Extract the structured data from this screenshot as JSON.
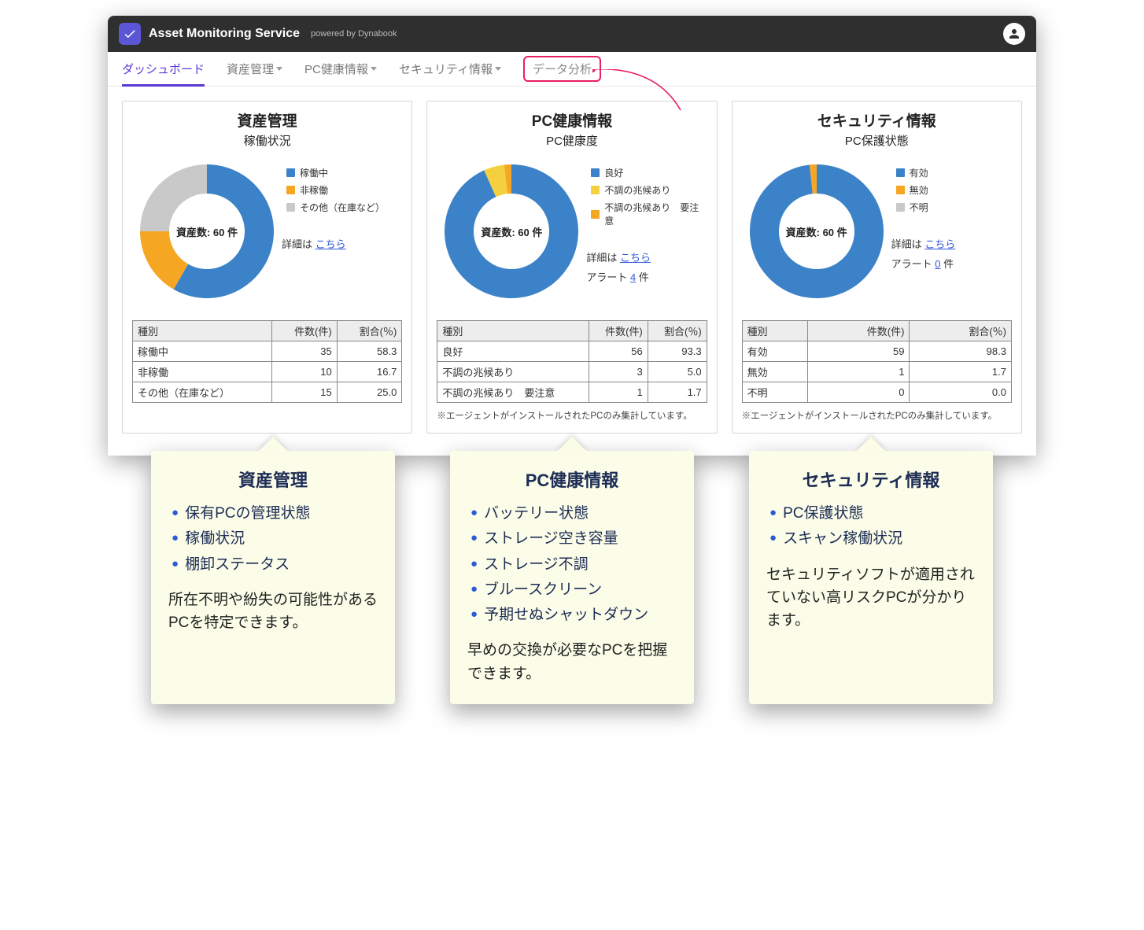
{
  "header": {
    "app_title": "Asset Monitoring Service",
    "app_subtitle": "powered by Dynabook"
  },
  "nav": {
    "items": [
      {
        "label": "ダッシュボード",
        "active": true,
        "dropdown": false
      },
      {
        "label": "資産管理",
        "active": false,
        "dropdown": true
      },
      {
        "label": "PC健康情報",
        "active": false,
        "dropdown": true
      },
      {
        "label": "セキュリティ情報",
        "active": false,
        "dropdown": true
      },
      {
        "label": "データ分析",
        "active": false,
        "dropdown": false,
        "highlight": true
      }
    ]
  },
  "colors": {
    "blue": "#3b82c8",
    "orange": "#f5a623",
    "gray": "#c9c9c9",
    "yellow": "#f4d03f"
  },
  "cards": [
    {
      "title": "資産管理",
      "subtitle": "稼働状況",
      "center_label": "資産数: 60 件",
      "legend": [
        {
          "label": "稼働中",
          "color": "#3b82c8"
        },
        {
          "label": "非稼働",
          "color": "#f5a623"
        },
        {
          "label": "その他（在庫など）",
          "color": "#c9c9c9"
        }
      ],
      "detail_prefix": "詳細は ",
      "detail_link": "こちら",
      "alert_prefix": null,
      "alert_count": null,
      "alert_suffix": null,
      "table": {
        "headers": [
          "種別",
          "件数(件)",
          "割合(％)"
        ],
        "rows": [
          [
            "稼働中",
            "35",
            "58.3"
          ],
          [
            "非稼働",
            "10",
            "16.7"
          ],
          [
            "その他（在庫など）",
            "15",
            "25.0"
          ]
        ]
      },
      "footnote": null
    },
    {
      "title": "PC健康情報",
      "subtitle": "PC健康度",
      "center_label": "資産数: 60 件",
      "legend": [
        {
          "label": "良好",
          "color": "#3b82c8"
        },
        {
          "label": "不調の兆候あり",
          "color": "#f4d03f"
        },
        {
          "label": "不調の兆候あり　要注意",
          "color": "#f5a623"
        }
      ],
      "detail_prefix": "詳細は ",
      "detail_link": "こちら",
      "alert_prefix": "アラート ",
      "alert_count": "4",
      "alert_suffix": " 件",
      "table": {
        "headers": [
          "種別",
          "件数(件)",
          "割合(％)"
        ],
        "rows": [
          [
            "良好",
            "56",
            "93.3"
          ],
          [
            "不調の兆候あり",
            "3",
            "5.0"
          ],
          [
            "不調の兆候あり　要注意",
            "1",
            "1.7"
          ]
        ]
      },
      "footnote": "※エージェントがインストールされたPCのみ集計しています。"
    },
    {
      "title": "セキュリティ情報",
      "subtitle": "PC保護状態",
      "center_label": "資産数: 60 件",
      "legend": [
        {
          "label": "有効",
          "color": "#3b82c8"
        },
        {
          "label": "無効",
          "color": "#f5a623"
        },
        {
          "label": "不明",
          "color": "#c9c9c9"
        }
      ],
      "detail_prefix": "詳細は ",
      "detail_link": "こちら",
      "alert_prefix": "アラート ",
      "alert_count": "0",
      "alert_suffix": " 件",
      "table": {
        "headers": [
          "種別",
          "件数(件)",
          "割合(％)"
        ],
        "rows": [
          [
            "有効",
            "59",
            "98.3"
          ],
          [
            "無効",
            "1",
            "1.7"
          ],
          [
            "不明",
            "0",
            "0.0"
          ]
        ]
      },
      "footnote": "※エージェントがインストールされたPCのみ集計しています。"
    }
  ],
  "chart_data": [
    {
      "type": "pie",
      "title": "資産管理 / 稼働状況",
      "total_label": "資産数: 60 件",
      "series": [
        {
          "name": "稼働中",
          "value": 35,
          "percent": 58.3,
          "color": "#3b82c8"
        },
        {
          "name": "非稼働",
          "value": 10,
          "percent": 16.7,
          "color": "#f5a623"
        },
        {
          "name": "その他（在庫など）",
          "value": 15,
          "percent": 25.0,
          "color": "#c9c9c9"
        }
      ]
    },
    {
      "type": "pie",
      "title": "PC健康情報 / PC健康度",
      "total_label": "資産数: 60 件",
      "series": [
        {
          "name": "良好",
          "value": 56,
          "percent": 93.3,
          "color": "#3b82c8"
        },
        {
          "name": "不調の兆候あり",
          "value": 3,
          "percent": 5.0,
          "color": "#f4d03f"
        },
        {
          "name": "不調の兆候あり　要注意",
          "value": 1,
          "percent": 1.7,
          "color": "#f5a623"
        }
      ]
    },
    {
      "type": "pie",
      "title": "セキュリティ情報 / PC保護状態",
      "total_label": "資産数: 60 件",
      "series": [
        {
          "name": "有効",
          "value": 59,
          "percent": 98.3,
          "color": "#3b82c8"
        },
        {
          "name": "無効",
          "value": 1,
          "percent": 1.7,
          "color": "#f5a623"
        },
        {
          "name": "不明",
          "value": 0,
          "percent": 0.0,
          "color": "#c9c9c9"
        }
      ]
    }
  ],
  "callouts": [
    {
      "title": "資産管理",
      "bullets": [
        "保有PCの管理状態",
        "稼働状況",
        "棚卸ステータス"
      ],
      "desc": "所在不明や紛失の可能性があるPCを特定できます。"
    },
    {
      "title": "PC健康情報",
      "bullets": [
        "バッテリー状態",
        "ストレージ空き容量",
        "ストレージ不調",
        "ブルースクリーン",
        "予期せぬシャットダウン"
      ],
      "desc": "早めの交換が必要なPCを把握できます。"
    },
    {
      "title": "セキュリティ情報",
      "bullets": [
        "PC保護状態",
        "スキャン稼働状況"
      ],
      "desc": "セキュリティソフトが適用されていない高リスクPCが分かります。"
    }
  ]
}
